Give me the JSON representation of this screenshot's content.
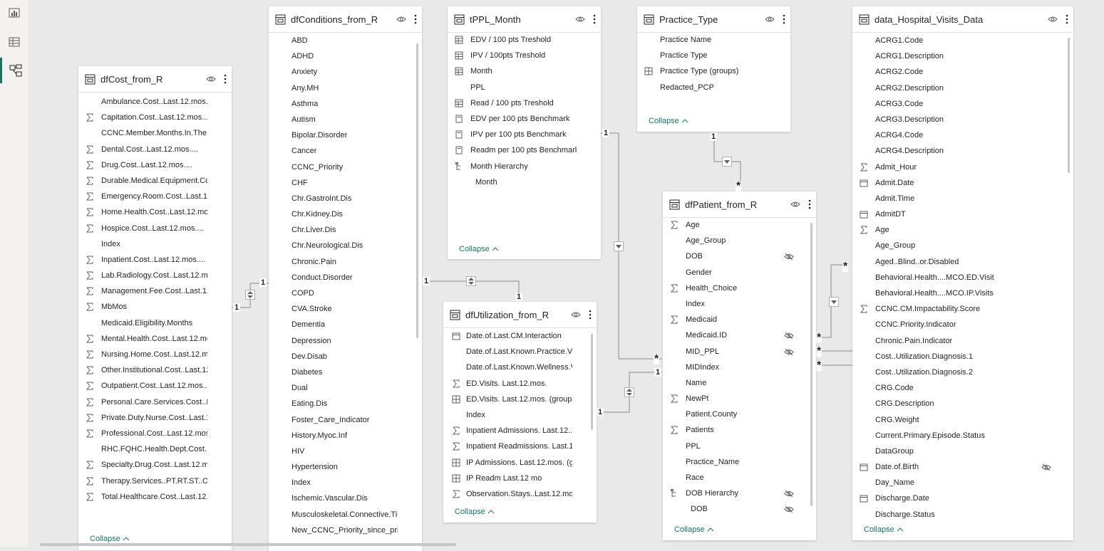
{
  "rail": {
    "items": [
      {
        "icon": "report-view-icon",
        "active": false
      },
      {
        "icon": "data-view-icon",
        "active": false
      },
      {
        "icon": "model-view-icon",
        "active": true
      }
    ]
  },
  "collapse_label": "Collapse",
  "tables": {
    "dfCost_from_R": {
      "title": "dfCost_from_R",
      "fields": [
        {
          "name": "Ambulance.Cost..Last.12.mos....",
          "icon": ""
        },
        {
          "name": "Capitation.Cost..Last.12.mos....",
          "icon": "sum"
        },
        {
          "name": "CCNC.Member.Months.In.The.P...",
          "icon": ""
        },
        {
          "name": "Dental.Cost..Last.12.mos....",
          "icon": "sum"
        },
        {
          "name": "Drug.Cost..Last.12.mos....",
          "icon": "sum"
        },
        {
          "name": "Durable.Medical.Equipment.Cos...",
          "icon": "sum"
        },
        {
          "name": "Emergency.Room.Cost..Last.12....",
          "icon": "sum"
        },
        {
          "name": "Home.Health.Cost..Last.12.mos....",
          "icon": "sum"
        },
        {
          "name": "Hospice.Cost..Last.12.mos....",
          "icon": "sum"
        },
        {
          "name": "Index",
          "icon": ""
        },
        {
          "name": "Inpatient.Cost..Last.12.mos....",
          "icon": "sum"
        },
        {
          "name": "Lab.Radiology.Cost..Last.12.mos....",
          "icon": "sum"
        },
        {
          "name": "Management.Fee.Cost..Last.12....",
          "icon": "sum"
        },
        {
          "name": "MbMos",
          "icon": "sum"
        },
        {
          "name": "Medicaid.Eligibility.Months",
          "icon": ""
        },
        {
          "name": "Mental.Health.Cost..Last.12.mos....",
          "icon": "sum"
        },
        {
          "name": "Nursing.Home.Cost..Last.12.mos....",
          "icon": "sum"
        },
        {
          "name": "Other.Institutional.Cost..Last.12....",
          "icon": "sum"
        },
        {
          "name": "Outpatient.Cost..Last.12.mos....",
          "icon": "sum"
        },
        {
          "name": "Personal.Care.Services.Cost..Last...",
          "icon": "sum"
        },
        {
          "name": "Private.Duty.Nurse.Cost..Last.12....",
          "icon": "sum"
        },
        {
          "name": "Professional.Cost..Last.12.mos....",
          "icon": "sum"
        },
        {
          "name": "RHC.FQHC.Health.Dept.Cost..La...",
          "icon": ""
        },
        {
          "name": "Specialty.Drug.Cost..Last.12.mos....",
          "icon": "sum"
        },
        {
          "name": "Therapy.Services..PT.RT.ST..Cost....",
          "icon": "sum"
        },
        {
          "name": "Total.Healthcare.Cost..Last.12.m....",
          "icon": "sum"
        }
      ]
    },
    "dfConditions_from_R": {
      "title": "dfConditions_from_R",
      "fields": [
        {
          "name": "ABD",
          "icon": ""
        },
        {
          "name": "ADHD",
          "icon": ""
        },
        {
          "name": "Anxiety",
          "icon": ""
        },
        {
          "name": "Any.MH",
          "icon": ""
        },
        {
          "name": "Asthma",
          "icon": ""
        },
        {
          "name": "Autism",
          "icon": ""
        },
        {
          "name": "Bipolar.Disorder",
          "icon": ""
        },
        {
          "name": "Cancer",
          "icon": ""
        },
        {
          "name": "CCNC_Priority",
          "icon": ""
        },
        {
          "name": "CHF",
          "icon": ""
        },
        {
          "name": "Chr.GastroInt.Dis",
          "icon": ""
        },
        {
          "name": "Chr.Kidney.Dis",
          "icon": ""
        },
        {
          "name": "Chr.Liver.Dis",
          "icon": ""
        },
        {
          "name": "Chr.Neurological.Dis",
          "icon": ""
        },
        {
          "name": "Chronic.Pain",
          "icon": ""
        },
        {
          "name": "Conduct.Disorder",
          "icon": ""
        },
        {
          "name": "COPD",
          "icon": ""
        },
        {
          "name": "CVA.Stroke",
          "icon": ""
        },
        {
          "name": "Dementia",
          "icon": ""
        },
        {
          "name": "Depression",
          "icon": ""
        },
        {
          "name": "Dev.Disab",
          "icon": ""
        },
        {
          "name": "Diabetes",
          "icon": ""
        },
        {
          "name": "Dual",
          "icon": ""
        },
        {
          "name": "Eating.Dis",
          "icon": ""
        },
        {
          "name": "Foster_Care_Indicator",
          "icon": ""
        },
        {
          "name": "History.Myoc.Inf",
          "icon": ""
        },
        {
          "name": "HIV",
          "icon": ""
        },
        {
          "name": "Hypertension",
          "icon": ""
        },
        {
          "name": "Index",
          "icon": ""
        },
        {
          "name": "Ischemic.Vascular.Dis",
          "icon": ""
        },
        {
          "name": "Musculoskeletal.Connective.Tis...",
          "icon": ""
        },
        {
          "name": "New_CCNC_Priority_since_prior...",
          "icon": ""
        }
      ]
    },
    "tPPL_Month": {
      "title": "tPPL_Month",
      "fields": [
        {
          "name": "EDV / 100 pts Treshold",
          "icon": "param"
        },
        {
          "name": "IPV / 100pts Treshold",
          "icon": "param"
        },
        {
          "name": "Month",
          "icon": "param"
        },
        {
          "name": "PPL",
          "icon": ""
        },
        {
          "name": "Read / 100 pts Treshold",
          "icon": "param"
        },
        {
          "name": "EDV per 100 pts Benchmark",
          "icon": "calc"
        },
        {
          "name": "IPV per 100 pts Benchmark",
          "icon": "calc"
        },
        {
          "name": "Readm per 100 pts Benchmark",
          "icon": "calc"
        },
        {
          "name": "Month Hierarchy",
          "icon": "hier"
        },
        {
          "name": "Month",
          "icon": "",
          "indent": true
        }
      ]
    },
    "Practice_Type": {
      "title": "Practice_Type",
      "fields": [
        {
          "name": "Practice Name",
          "icon": ""
        },
        {
          "name": "Practice Type",
          "icon": ""
        },
        {
          "name": "Practice Type (groups)",
          "icon": "group"
        },
        {
          "name": "Redacted_PCP",
          "icon": ""
        }
      ]
    },
    "dfUtilization_from_R": {
      "title": "dfUtilization_from_R",
      "fields": [
        {
          "name": "Date.of.Last.CM.Interaction",
          "icon": "cal"
        },
        {
          "name": "Date.of.Last.Known.Practice.Visit",
          "icon": ""
        },
        {
          "name": "Date.of.Last.Known.Wellness.Visit",
          "icon": ""
        },
        {
          "name": "ED.Visits. Last.12.mos.",
          "icon": "sum"
        },
        {
          "name": "ED.Visits. Last.12.mos. (groups)",
          "icon": "group"
        },
        {
          "name": "Index",
          "icon": ""
        },
        {
          "name": "Inpatient Admissions. Last.12....",
          "icon": "sum"
        },
        {
          "name": "Inpatient Readmissions. Last.12....",
          "icon": "sum"
        },
        {
          "name": "IP Admissions. Last.12.mos. (gr...",
          "icon": "group"
        },
        {
          "name": "IP Readm Last.12 mo",
          "icon": "group"
        },
        {
          "name": "Observation.Stays..Last.12.mos.",
          "icon": "sum"
        }
      ]
    },
    "dfPatient_from_R": {
      "title": "dfPatient_from_R",
      "fields": [
        {
          "name": "Age",
          "icon": "sum"
        },
        {
          "name": "Age_Group",
          "icon": ""
        },
        {
          "name": "DOB",
          "icon": "",
          "hidden": true
        },
        {
          "name": "Gender",
          "icon": ""
        },
        {
          "name": "Health_Choice",
          "icon": "sum"
        },
        {
          "name": "Index",
          "icon": ""
        },
        {
          "name": "Medicaid",
          "icon": "sum"
        },
        {
          "name": "Medicaid.ID",
          "icon": "",
          "hidden": true
        },
        {
          "name": "MID_PPL",
          "icon": "",
          "hidden": true
        },
        {
          "name": "MIDIndex",
          "icon": ""
        },
        {
          "name": "Name",
          "icon": ""
        },
        {
          "name": "NewPt",
          "icon": "sum"
        },
        {
          "name": "Patient.County",
          "icon": ""
        },
        {
          "name": "Patients",
          "icon": "sum"
        },
        {
          "name": "PPL",
          "icon": ""
        },
        {
          "name": "Practice_Name",
          "icon": ""
        },
        {
          "name": "Race",
          "icon": ""
        },
        {
          "name": "DOB Hierarchy",
          "icon": "hier",
          "hidden": true
        },
        {
          "name": "DOB",
          "icon": "",
          "indent": true,
          "hidden": true
        }
      ]
    },
    "data_Hospital_Visits_Data": {
      "title": "data_Hospital_Visits_Data",
      "fields": [
        {
          "name": "ACRG1.Code",
          "icon": ""
        },
        {
          "name": "ACRG1.Description",
          "icon": ""
        },
        {
          "name": "ACRG2.Code",
          "icon": ""
        },
        {
          "name": "ACRG2.Description",
          "icon": ""
        },
        {
          "name": "ACRG3.Code",
          "icon": ""
        },
        {
          "name": "ACRG3.Description",
          "icon": ""
        },
        {
          "name": "ACRG4.Code",
          "icon": ""
        },
        {
          "name": "ACRG4.Description",
          "icon": ""
        },
        {
          "name": "Admit_Hour",
          "icon": "sum"
        },
        {
          "name": "Admit.Date",
          "icon": "cal"
        },
        {
          "name": "Admit.Time",
          "icon": ""
        },
        {
          "name": "AdmitDT",
          "icon": "cal"
        },
        {
          "name": "Age",
          "icon": "sum"
        },
        {
          "name": "Age_Group",
          "icon": ""
        },
        {
          "name": "Aged..Blind..or.Disabled",
          "icon": ""
        },
        {
          "name": "Behavioral.Health....MCO.ED.Visit",
          "icon": ""
        },
        {
          "name": "Behavioral.Health....MCO.IP.Visits",
          "icon": ""
        },
        {
          "name": "CCNC.CM.Impactability.Score",
          "icon": "sum"
        },
        {
          "name": "CCNC.Priority.Indicator",
          "icon": ""
        },
        {
          "name": "Chronic.Pain.Indicator",
          "icon": ""
        },
        {
          "name": "Cost..Utilization.Diagnosis.1",
          "icon": ""
        },
        {
          "name": "Cost..Utilization.Diagnosis.2",
          "icon": ""
        },
        {
          "name": "CRG.Code",
          "icon": ""
        },
        {
          "name": "CRG.Description",
          "icon": ""
        },
        {
          "name": "CRG.Weight",
          "icon": ""
        },
        {
          "name": "Current.Primary.Episode.Status",
          "icon": ""
        },
        {
          "name": "DataGroup",
          "icon": ""
        },
        {
          "name": "Date.of.Birth",
          "icon": "cal",
          "hidden": true
        },
        {
          "name": "Day_Name",
          "icon": ""
        },
        {
          "name": "Discharge.Date",
          "icon": "cal"
        },
        {
          "name": "Discharge.Status",
          "icon": ""
        }
      ]
    }
  },
  "relationships": {
    "cost_conditions": {
      "left": "1",
      "right": "1"
    },
    "conditions_util": {
      "left": "1",
      "right": "1"
    },
    "ppl_patient": {
      "left": "1",
      "right": "*"
    },
    "practice_patient": {
      "left": "1",
      "right": "*"
    },
    "util_patient": {
      "left": "1",
      "right": "1"
    },
    "patient_hospital": {
      "m1": "*",
      "m2": "*",
      "m3": "*",
      "h": "*"
    }
  }
}
